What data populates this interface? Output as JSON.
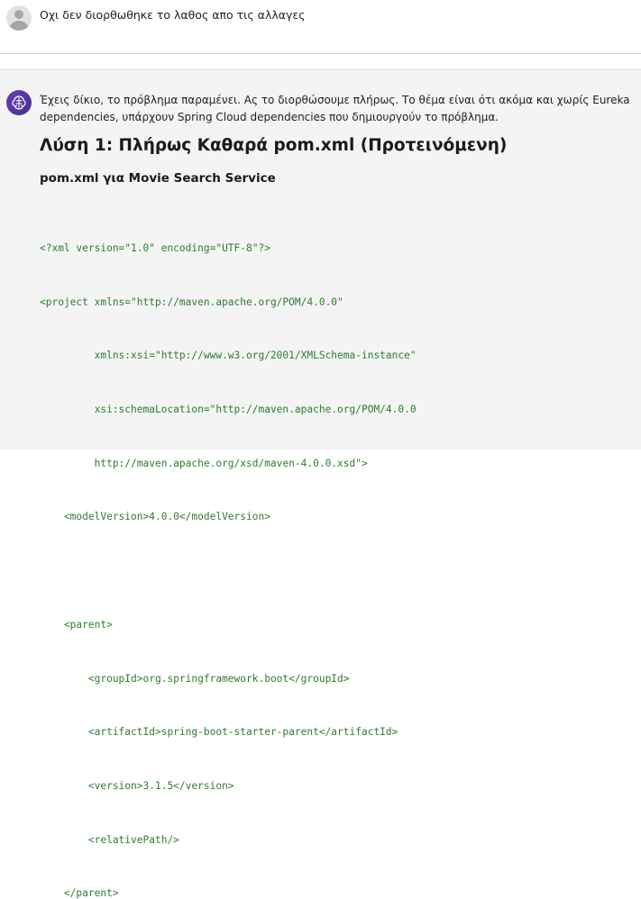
{
  "user_message": {
    "text": "Οχι δεν διορθωθηκε το λαθος απο τις αλλαγες"
  },
  "assistant_message": {
    "intro_line_1": "Έχεις δίκιο, το πρόβλημα παραμένει. Ας το διορθώσουμε πλήρως. Το θέμα είναι ότι ακόμα και χωρίς Eureka",
    "intro_line_2": "dependencies, υπάρχουν Spring Cloud dependencies που δημιουργούν το πρόβλημα.",
    "heading": "Λύση 1: Πλήρως Καθαρά pom.xml (Προτεινόμενη)",
    "subheading": "pom.xml για Movie Search Service",
    "code_lines": [
      "<?xml version=\"1.0\" encoding=\"UTF-8\"?>",
      "<project xmlns=\"http://maven.apache.org/POM/4.0.0\"",
      "         xmlns:xsi=\"http://www.w3.org/2001/XMLSchema-instance\"",
      "         xsi:schemaLocation=\"http://maven.apache.org/POM/4.0.0",
      "         http://maven.apache.org/xsd/maven-4.0.0.xsd\">",
      "    <modelVersion>4.0.0</modelVersion>",
      "",
      "    <parent>",
      "        <groupId>org.springframework.boot</groupId>",
      "        <artifactId>spring-boot-starter-parent</artifactId>",
      "        <version>3.1.5</version>",
      "        <relativePath/>",
      "    </parent>"
    ]
  },
  "icons": {
    "user_avatar": "user-avatar-icon",
    "assistant_avatar": "brain-icon"
  },
  "colors": {
    "code_text": "#2d7d2d",
    "assistant_bg": "#f4f4f4",
    "avatar_purple": "#5a34a0"
  }
}
